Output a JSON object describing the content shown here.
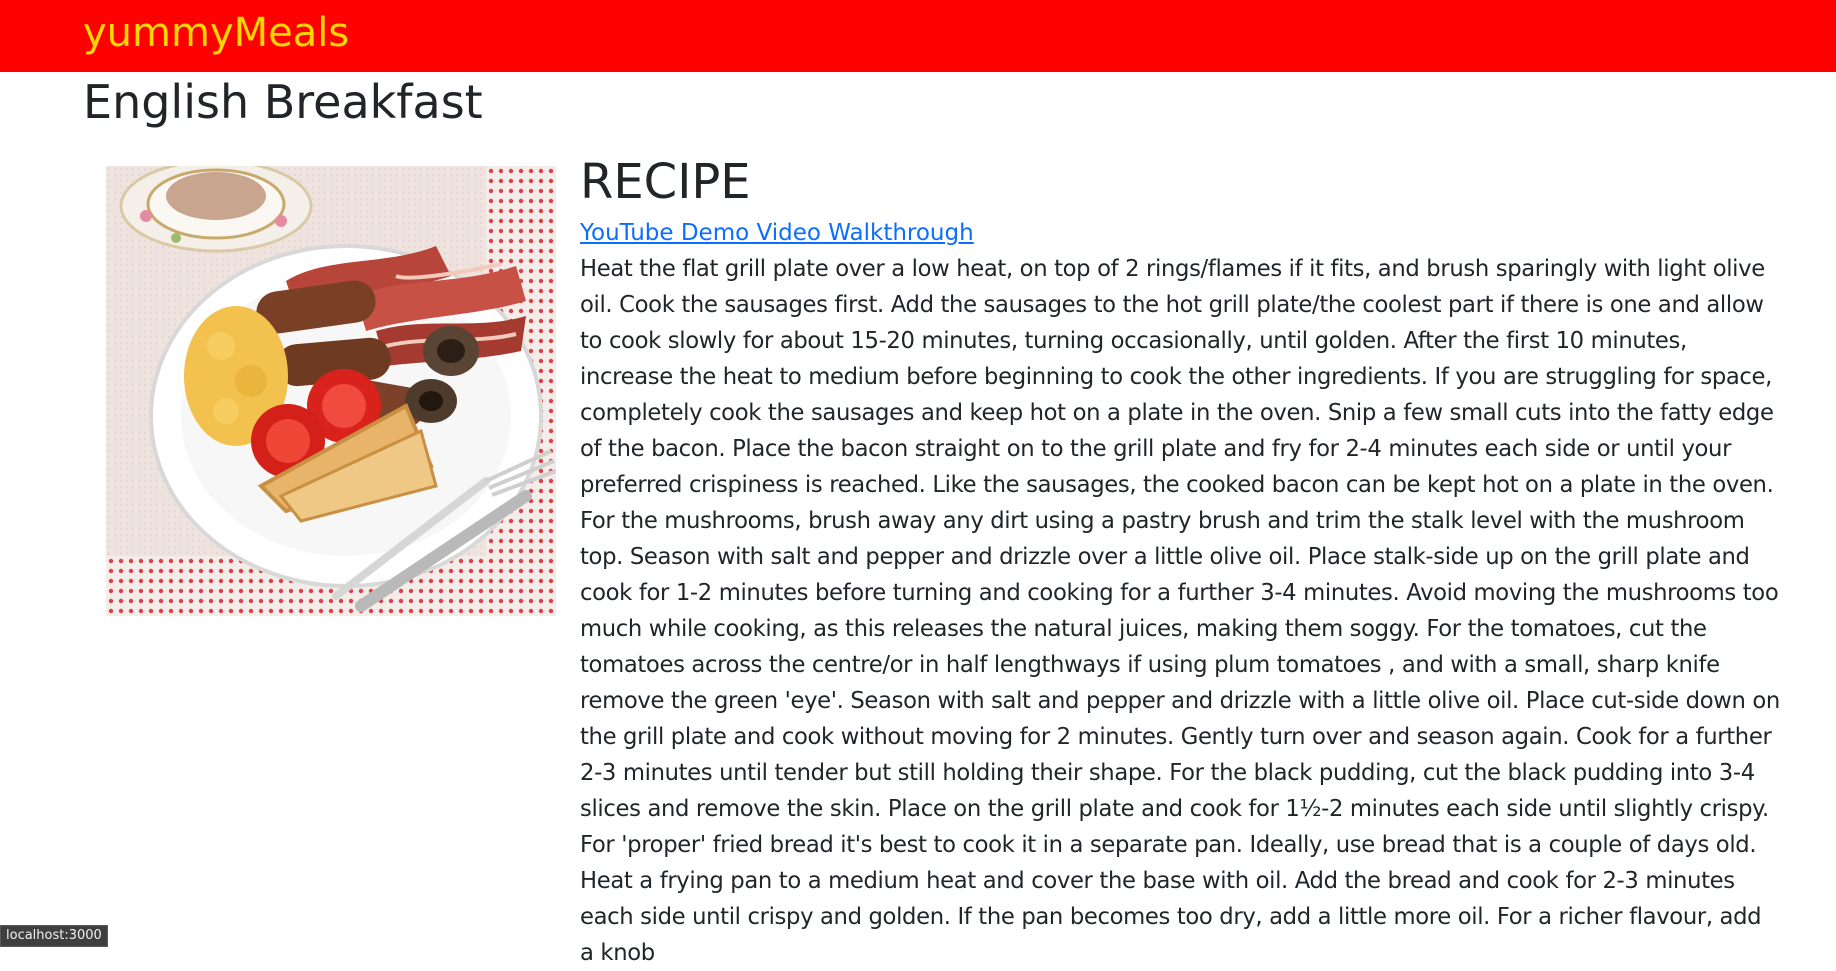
{
  "navbar": {
    "brand": "yummyMeals",
    "background_color": "#ff0000",
    "brand_color": "#ffd700"
  },
  "meal": {
    "title": "English Breakfast"
  },
  "recipe": {
    "heading": "RECIPE",
    "video_link_label": "YouTube Demo Video Walkthrough",
    "instructions": "Heat the flat grill plate over a low heat, on top of 2 rings/flames if it fits, and brush sparingly with light olive oil. Cook the sausages first. Add the sausages to the hot grill plate/the coolest part if there is one and allow to cook slowly for about 15-20 minutes, turning occasionally, until golden. After the first 10 minutes, increase the heat to medium before beginning to cook the other ingredients. If you are struggling for space, completely cook the sausages and keep hot on a plate in the oven. Snip a few small cuts into the fatty edge of the bacon. Place the bacon straight on to the grill plate and fry for 2-4 minutes each side or until your preferred crispiness is reached. Like the sausages, the cooked bacon can be kept hot on a plate in the oven. For the mushrooms, brush away any dirt using a pastry brush and trim the stalk level with the mushroom top. Season with salt and pepper and drizzle over a little olive oil. Place stalk-side up on the grill plate and cook for 1-2 minutes before turning and cooking for a further 3-4 minutes. Avoid moving the mushrooms too much while cooking, as this releases the natural juices, making them soggy. For the tomatoes, cut the tomatoes across the centre/or in half lengthways if using plum tomatoes , and with a small, sharp knife remove the green 'eye'. Season with salt and pepper and drizzle with a little olive oil. Place cut-side down on the grill plate and cook without moving for 2 minutes. Gently turn over and season again. Cook for a further 2-3 minutes until tender but still holding their shape. For the black pudding, cut the black pudding into 3-4 slices and remove the skin. Place on the grill plate and cook for 1½-2 minutes each side until slightly crispy. For 'proper' fried bread it's best to cook it in a separate pan. Ideally, use bread that is a couple of days old. Heat a frying pan to a medium heat and cover the base with oil. Add the bread and cook for 2-3 minutes each side until crispy and golden. If the pan becomes too dry, add a little more oil. For a richer flavour, add a knob"
  },
  "status_bar": {
    "url": "localhost:3000"
  }
}
